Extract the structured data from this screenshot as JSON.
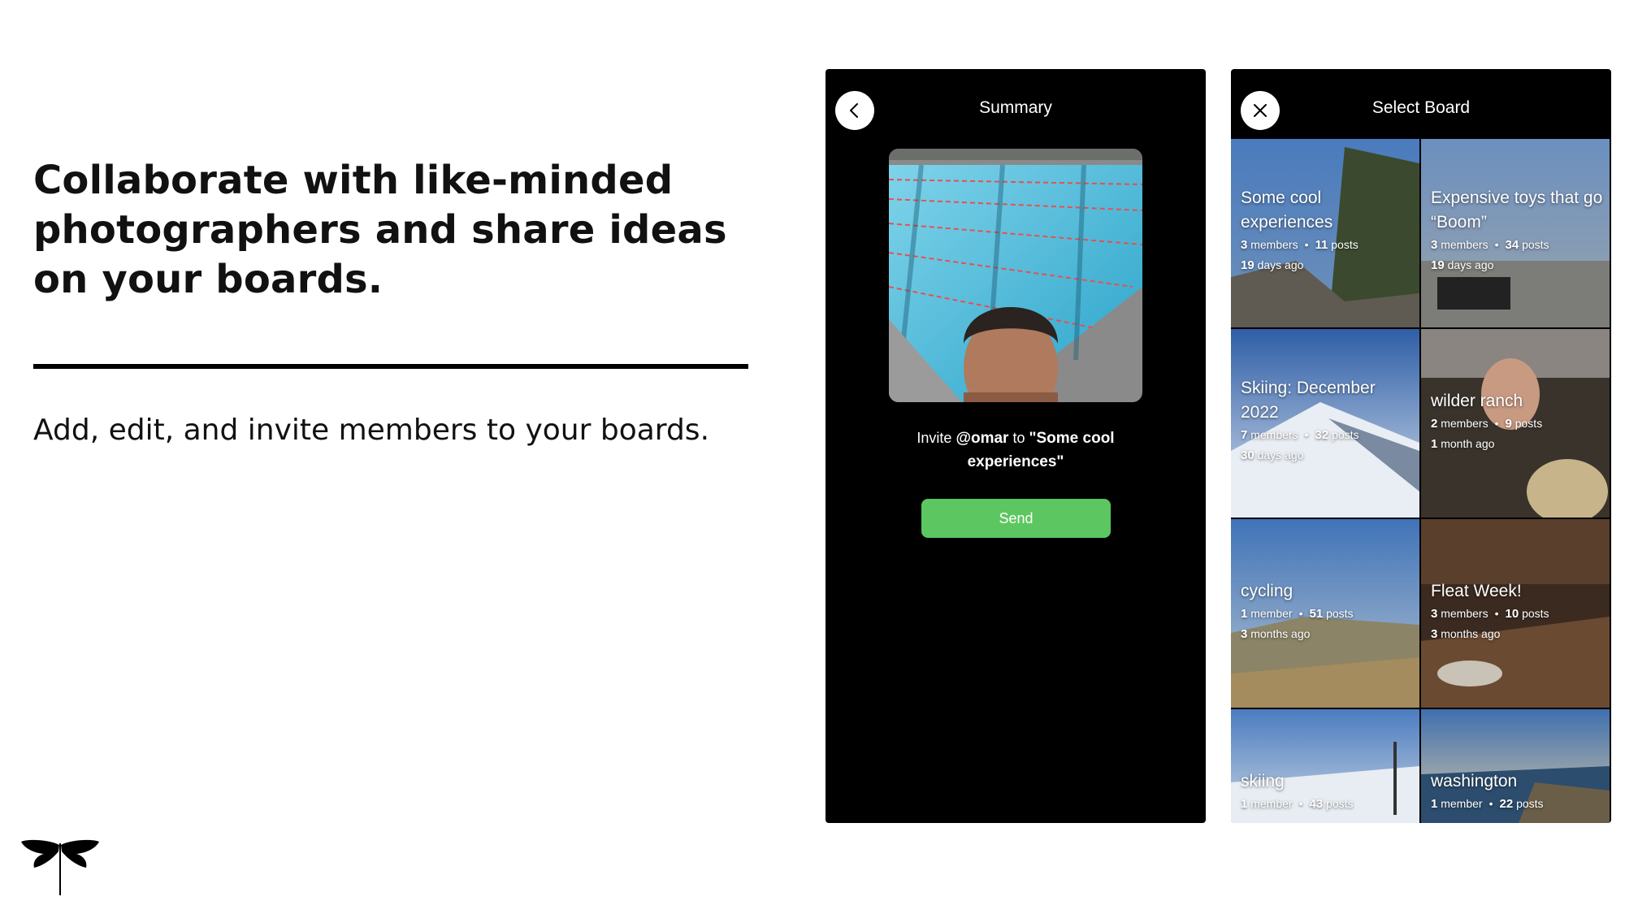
{
  "headline": "Collaborate with like-minded photographers and share ideas on your boards.",
  "subhead": "Add, edit, and invite members to your boards.",
  "summary_screen": {
    "title": "Summary",
    "invite_prefix": "Invite",
    "invite_user": "@omar",
    "invite_to": "to",
    "invite_board": "\"Some cool experiences\"",
    "send_label": "Send",
    "send_color": "#5cc760"
  },
  "select_screen": {
    "title": "Select Board",
    "boards": [
      {
        "name": "Some cool experiences",
        "members_n": "3",
        "members_word": "members",
        "posts_n": "11",
        "posts_word": "posts",
        "age_n": "19",
        "age_word": "days ago"
      },
      {
        "name": "Expensive toys that go “Boom”",
        "members_n": "3",
        "members_word": "members",
        "posts_n": "34",
        "posts_word": "posts",
        "age_n": "19",
        "age_word": "days ago"
      },
      {
        "name": "Skiing: December 2022",
        "members_n": "7",
        "members_word": "members",
        "posts_n": "32",
        "posts_word": "posts",
        "age_n": "30",
        "age_word": "days ago"
      },
      {
        "name": "wilder ranch",
        "members_n": "2",
        "members_word": "members",
        "posts_n": "9",
        "posts_word": "posts",
        "age_n": "1",
        "age_word": "month ago"
      },
      {
        "name": "cycling",
        "members_n": "1",
        "members_word": "member",
        "posts_n": "51",
        "posts_word": "posts",
        "age_n": "3",
        "age_word": "months ago"
      },
      {
        "name": "Fleat Week!",
        "members_n": "3",
        "members_word": "members",
        "posts_n": "10",
        "posts_word": "posts",
        "age_n": "3",
        "age_word": "months ago"
      },
      {
        "name": "skiing",
        "members_n": "1",
        "members_word": "member",
        "posts_n": "43",
        "posts_word": "posts",
        "age_n": "",
        "age_word": ""
      },
      {
        "name": "washington",
        "members_n": "1",
        "members_word": "member",
        "posts_n": "22",
        "posts_word": "posts",
        "age_n": "",
        "age_word": ""
      }
    ]
  },
  "icons": {
    "back": "chevron-left-icon",
    "close": "close-icon",
    "logo": "dragonfly-logo"
  }
}
